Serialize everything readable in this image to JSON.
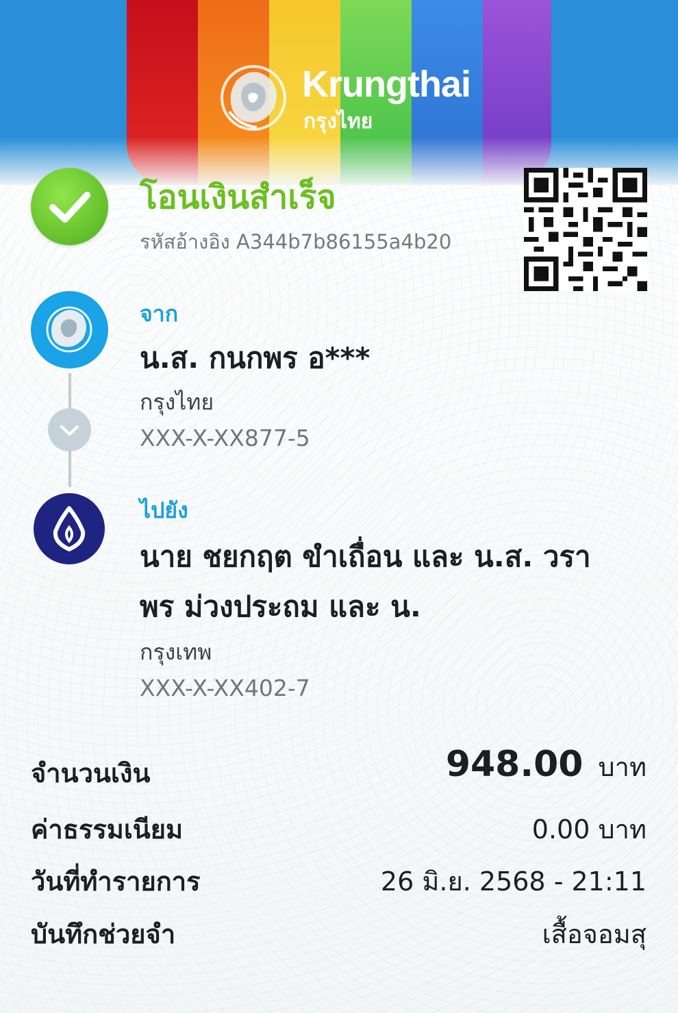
{
  "header": {
    "brand_en": "Krungthai",
    "brand_th": "กรุงไทย",
    "colors": {
      "primary_blue": "#2a8fd8",
      "success_green": "#6bbf1f",
      "accent_blue": "#1ca0dd",
      "bbl_navy": "#1e2481"
    }
  },
  "status": {
    "title": "โอนเงินสำเร็จ",
    "reference": "รหัสอ้างอิง A344b7b86155a4b20",
    "icon": "check-icon"
  },
  "from": {
    "label": "จาก",
    "name": "น.ส. กนกพร อ***",
    "bank": "กรุงไทย",
    "account": "XXX-X-XX877-5",
    "icon": "krungthai-logo-icon"
  },
  "to": {
    "label": "ไปยัง",
    "name_line1": "นาย ชยกฤต ขำเถื่อน และ น.ส. วรา",
    "name_line2": "พร ม่วงประถม และ น.",
    "bank": "กรุงเทพ",
    "account": "XXX-X-XX402-7",
    "icon": "bangkok-bank-logo-icon"
  },
  "details": {
    "amount_label": "จำนวนเงิน",
    "amount_value": "948.00",
    "amount_unit": "บาท",
    "fee_label": "ค่าธรรมเนียม",
    "fee_value": "0.00 บาท",
    "date_label": "วันที่ทำรายการ",
    "date_value": "26 มิ.ย. 2568 - 21:11",
    "memo_label": "บันทึกช่วยจำ",
    "memo_value": "เสื้อจอมสุ"
  }
}
